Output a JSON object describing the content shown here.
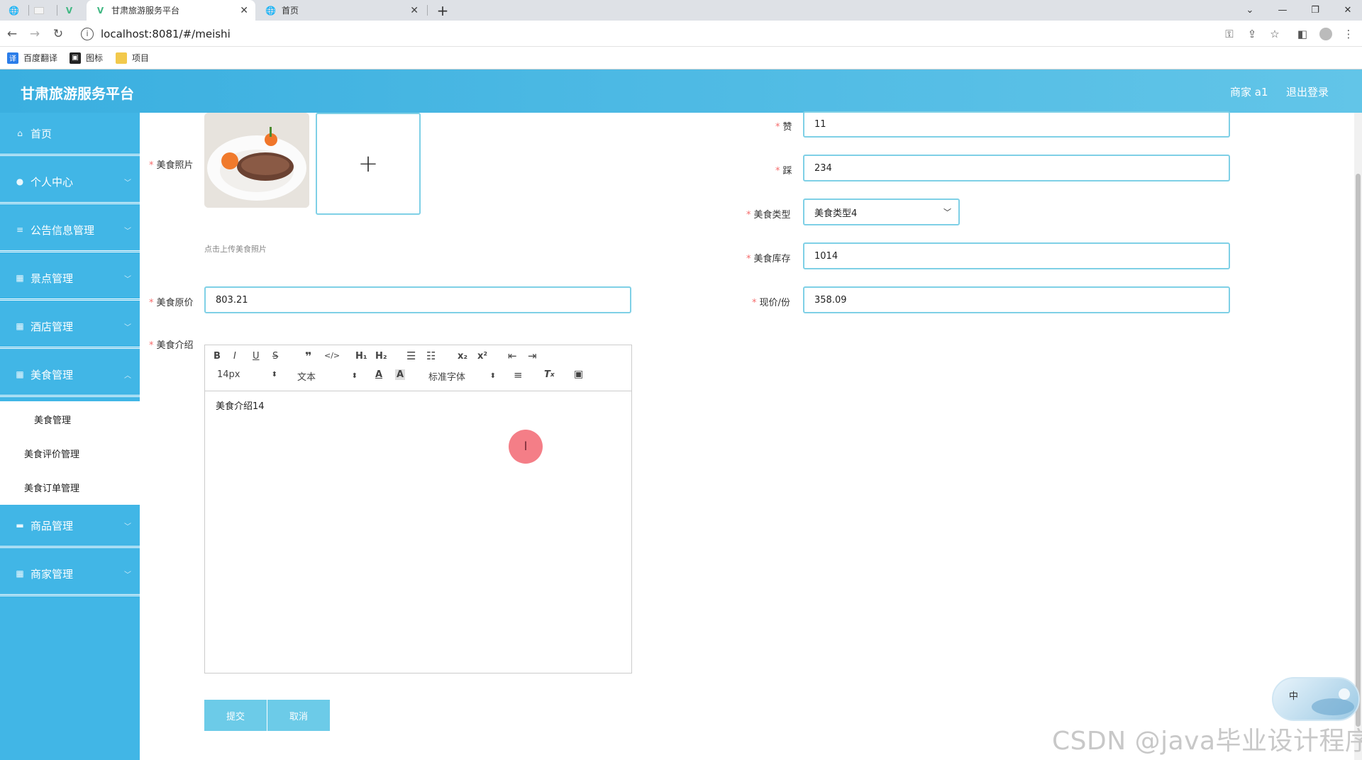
{
  "browser": {
    "tabs": [
      {
        "title": "甘肃旅游服务平台",
        "active": true
      },
      {
        "title": "首页",
        "active": false
      }
    ],
    "url": "localhost:8081/#/meishi",
    "bookmarks": [
      "百度翻译",
      "图标",
      "项目"
    ],
    "icons": [
      "back-icon",
      "forward-icon",
      "reload-icon",
      "key-icon",
      "share-icon",
      "star-icon",
      "sidepanel-icon",
      "profile-icon",
      "menu-dots-icon"
    ]
  },
  "header": {
    "title": "甘肃旅游服务平台",
    "user": "商家 a1",
    "logout": "退出登录"
  },
  "sidebar": {
    "items": [
      {
        "label": "首页",
        "icon": "home-icon"
      },
      {
        "label": "个人中心",
        "icon": "user-icon"
      },
      {
        "label": "公告信息管理",
        "icon": "list-icon"
      },
      {
        "label": "景点管理",
        "icon": "grid-icon"
      },
      {
        "label": "酒店管理",
        "icon": "grid-icon"
      },
      {
        "label": "美食管理",
        "icon": "grid-icon"
      },
      {
        "label": "商品管理",
        "icon": "chat-icon"
      },
      {
        "label": "商家管理",
        "icon": "grid-icon"
      }
    ],
    "submenu": [
      "美食管理",
      "美食评价管理",
      "美食订单管理"
    ]
  },
  "form": {
    "photo_label": "美食照片",
    "photo_hint": "点击上传美食照片",
    "original_price_label": "美食原价",
    "original_price_value": "803.21",
    "intro_label": "美食介绍",
    "intro_value": "美食介绍14",
    "like_label": "赞",
    "like_value": "11",
    "dislike_label": "踩",
    "dislike_value": "234",
    "type_label": "美食类型",
    "type_value": "美食类型4",
    "stock_label": "美食库存",
    "stock_value": "1014",
    "price_label": "现价/份",
    "price_value": "358.09",
    "submit": "提交",
    "cancel": "取消"
  },
  "editor": {
    "font_size": "14px",
    "paragraph": "文本",
    "font_family": "标准字体"
  },
  "ime_label": "中",
  "watermark": "CSDN @java毕业设计程序"
}
